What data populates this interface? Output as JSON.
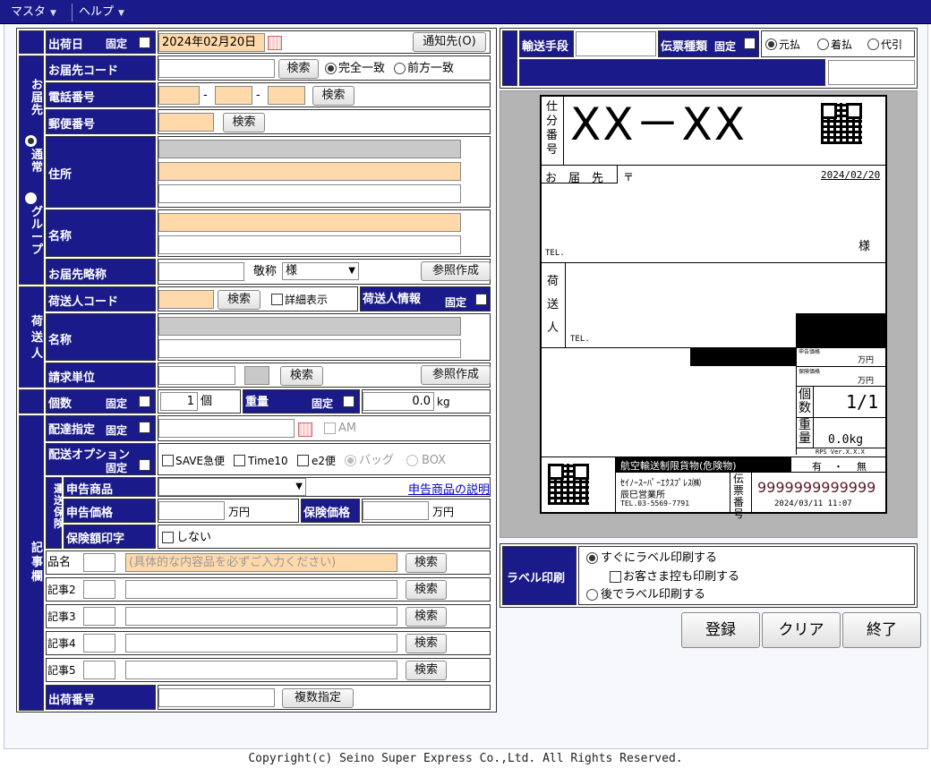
{
  "menu": {
    "items": [
      {
        "label": "マスタ"
      },
      {
        "label": "ヘルプ"
      }
    ]
  },
  "colors": {
    "header": "#1a1a8a",
    "required": "#ffd9aa",
    "disabled": "#c9c9c9",
    "link": "#0000cc"
  },
  "form": {
    "ship_date": {
      "label": "出荷日",
      "fixed_label": "固定",
      "value": "2024年02月20日",
      "notify_button": "通知先(O)"
    },
    "dest_group": {
      "label": "お届先",
      "opt_normal": "通常",
      "opt_group": "グループ"
    },
    "dest_code": {
      "label": "お届先コード",
      "search": "検索",
      "opt_exact": "完全一致",
      "opt_prefix": "前方一致"
    },
    "phone": {
      "label": "電話番号",
      "dash": "-",
      "search": "検索"
    },
    "postal": {
      "label": "郵便番号",
      "search": "検索"
    },
    "address": {
      "label": "住所"
    },
    "name": {
      "label": "名称"
    },
    "dest_short": {
      "label": "お届先略称",
      "honorific_label": "敬称",
      "honorific_value": "様",
      "ref_button": "参照作成"
    },
    "sender_group": {
      "label": "荷送人"
    },
    "sender_code": {
      "label": "荷送人コード",
      "search": "検索",
      "detail": "詳細表示",
      "info_label": "荷送人情報",
      "fixed_label": "固定"
    },
    "sender_name": {
      "label": "名称"
    },
    "billing": {
      "label": "請求単位",
      "search": "検索",
      "ref_button": "参照作成"
    },
    "count": {
      "label": "個数",
      "fixed_label": "固定",
      "value": "1",
      "unit": "個"
    },
    "weight": {
      "label": "重量",
      "fixed_label": "固定",
      "value": "0.0",
      "unit": "kg"
    },
    "notes_group": {
      "label": "記事欄"
    },
    "delivery": {
      "label": "配達指定",
      "fixed_label": "固定",
      "am": "AM"
    },
    "options": {
      "label": "配送オプション",
      "fixed_label": "固定",
      "opts": [
        "SAVE急便",
        "Time10",
        "e2便",
        "バッグ",
        "BOX"
      ]
    },
    "insurance_group": {
      "label": "運送保険"
    },
    "decl_goods": {
      "label": "申告商品",
      "link": "申告商品の説明"
    },
    "decl_price": {
      "label": "申告価格",
      "unit": "万円",
      "ins_label": "保険価格",
      "ins_unit": "万円"
    },
    "ins_print": {
      "label": "保険額印字",
      "opt": "しない"
    },
    "item": {
      "label": "品名",
      "placeholder": "(具体的な内容品を必ずご入力ください)",
      "search": "検索"
    },
    "notes": [
      {
        "label": "記事2",
        "search": "検索"
      },
      {
        "label": "記事3",
        "search": "検索"
      },
      {
        "label": "記事4",
        "search": "検索"
      },
      {
        "label": "記事5",
        "search": "検索"
      }
    ],
    "ship_no": {
      "label": "出荷番号",
      "button": "複数指定"
    }
  },
  "transport": {
    "means_label": "輸送手段",
    "slip_label": "伝票種類",
    "fixed_label": "固定",
    "opts": [
      "元払",
      "着払",
      "代引"
    ]
  },
  "label_preview": {
    "sort_label": "仕分番号",
    "sort_value": "XX－XX",
    "dest_label": "お　届　先",
    "postal_mark": "〒",
    "date": "2024/02/20",
    "tel": "TEL.",
    "sama": "様",
    "sender_label": "荷送人",
    "sender_tel": "TEL.",
    "decl_price": "申告価格",
    "man_yen": "万円",
    "ins_price": "保険価格",
    "man_yen2": "万円",
    "count_label": "個数",
    "count_value": "1/1",
    "weight_label": "重量",
    "weight_value": "0.0kg",
    "version": "RPS Ver.X.X.X",
    "air_notice": "航空輸送制限貨物(危険物)",
    "air_yes": "有",
    "air_dot": "・",
    "air_no": "無",
    "company": "ｾｲﾉｰｽｰﾊﾟｰｴｸｽﾌﾟﾚｽ㈱",
    "branch": "辰巳営業所",
    "company_tel": "TEL.03-5569-7791",
    "slip_label": "伝票番号",
    "slip_number": "9999999999999",
    "slip_datetime": "2024/03/11 11:07"
  },
  "print": {
    "label": "ラベル印刷",
    "opt_now": "すぐにラベル印刷する",
    "opt_copy": "お客さま控も印刷する",
    "opt_later": "後でラベル印刷する"
  },
  "actions": {
    "register": "登録",
    "clear": "クリア",
    "exit": "終了"
  },
  "footer": "Copyright(c)  Seino Super Express Co.,Ltd. All Rights Reserved."
}
